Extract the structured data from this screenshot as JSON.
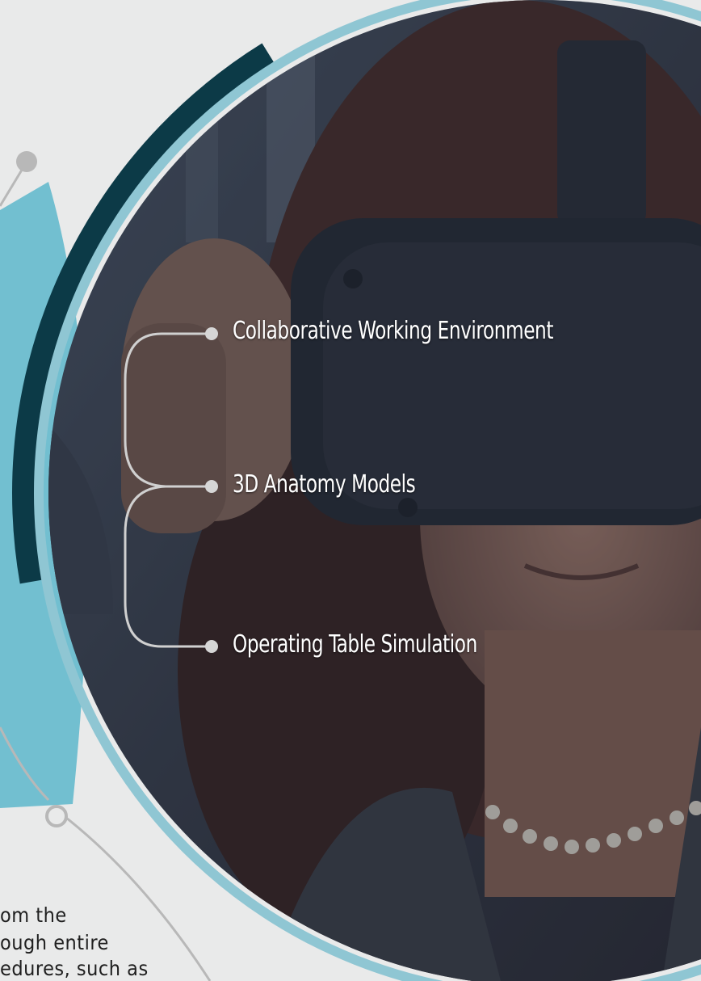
{
  "colors": {
    "background": "#e9eaea",
    "dark_teal": "#0c3a47",
    "light_blue": "#72bfd0",
    "ring_teal": "#1f6f83",
    "connector_grey": "#b8b8b8",
    "label_text": "#ffffff",
    "body_text": "#1f1f1f"
  },
  "photo": {
    "subject": "woman wearing VR headset",
    "icon": "vr-headset-photo"
  },
  "features": [
    {
      "label": "Collaborative Working Environment"
    },
    {
      "label": "3D Anatomy Models"
    },
    {
      "label": "Operating Table Simulation"
    }
  ],
  "body_text": {
    "line1": "om   the",
    "line2": "ough  entire",
    "line3": "edures,  such  as"
  }
}
